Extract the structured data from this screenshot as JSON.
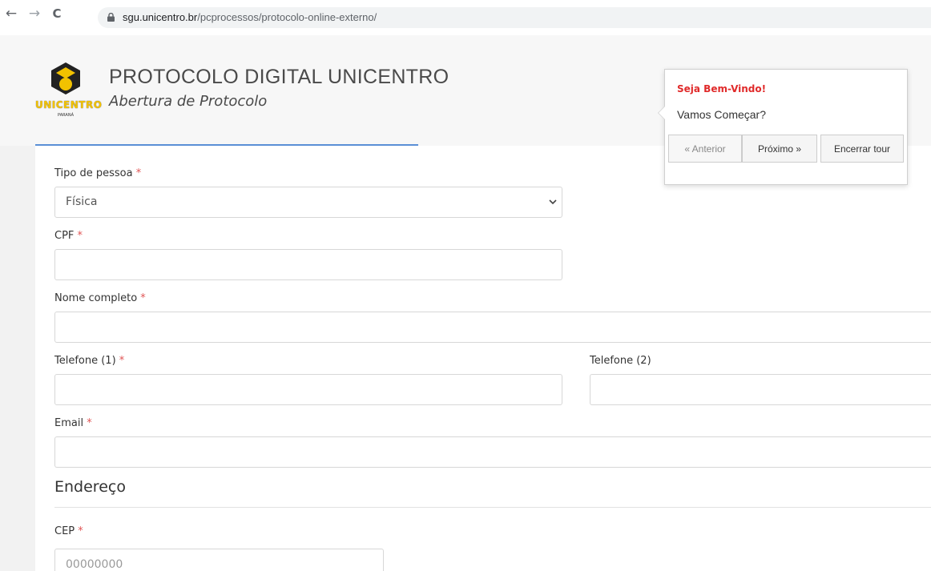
{
  "browser": {
    "url_host": "sgu.unicentro.br",
    "url_path": "/pcprocessos/protocolo-online-externo/",
    "back_glyph": "←",
    "forward_glyph": "→",
    "reload_glyph": "C"
  },
  "header": {
    "logo_text": "UNICENTRO",
    "logo_sub": "PARANÁ",
    "title": "PROTOCOLO DIGITAL UNICENTRO",
    "subtitle": "Abertura de Protocolo"
  },
  "tour": {
    "title": "Seja Bem-Vindo!",
    "content": "Vamos Começar?",
    "prev_label": "« Anterior",
    "next_label": "Próximo »",
    "end_label": "Encerrar tour"
  },
  "form": {
    "required_mark": "*",
    "tipo_pessoa": {
      "label": "Tipo de pessoa",
      "value": "Física"
    },
    "cpf": {
      "label": "CPF",
      "value": ""
    },
    "nome": {
      "label": "Nome completo",
      "value": ""
    },
    "telefone1": {
      "label": "Telefone (1)",
      "value": ""
    },
    "telefone2": {
      "label": "Telefone (2)",
      "value": ""
    },
    "email": {
      "label": "Email",
      "value": ""
    },
    "endereco_title": "Endereço",
    "cep": {
      "label": "CEP",
      "placeholder": "00000000"
    }
  },
  "colors": {
    "accent": "#5b8fd6",
    "required": "#e05555",
    "tour_title": "#e02a2a",
    "logo_yellow": "#f2c200"
  }
}
